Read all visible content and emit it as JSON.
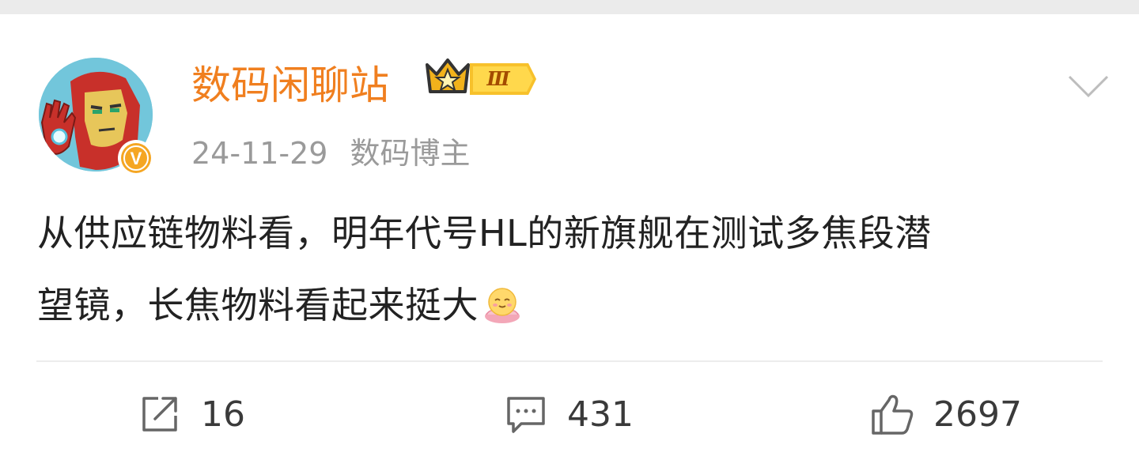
{
  "post": {
    "username": "数码闲聊站",
    "rank_level": "Ⅲ",
    "date": "24-11-29",
    "role": "数码博主",
    "text_line1": "从供应链物料看，明年代号HL的新旗舰在测试多焦段潜",
    "text_line2": "望镜，长焦物料看起来挺大",
    "emoji": "lotus-smile-emoji",
    "avatar": "iron-man-avatar",
    "verify_badge": "V",
    "verify_color": "#f5a623"
  },
  "actions": {
    "repost": {
      "icon": "share-icon",
      "count": "16"
    },
    "comment": {
      "icon": "comment-icon",
      "count": "431"
    },
    "like": {
      "icon": "thumbs-up-icon",
      "count": "2697"
    }
  },
  "colors": {
    "username": "#f07f1f",
    "meta": "#9a9a9a",
    "text": "#222222",
    "icon": "#666666"
  }
}
